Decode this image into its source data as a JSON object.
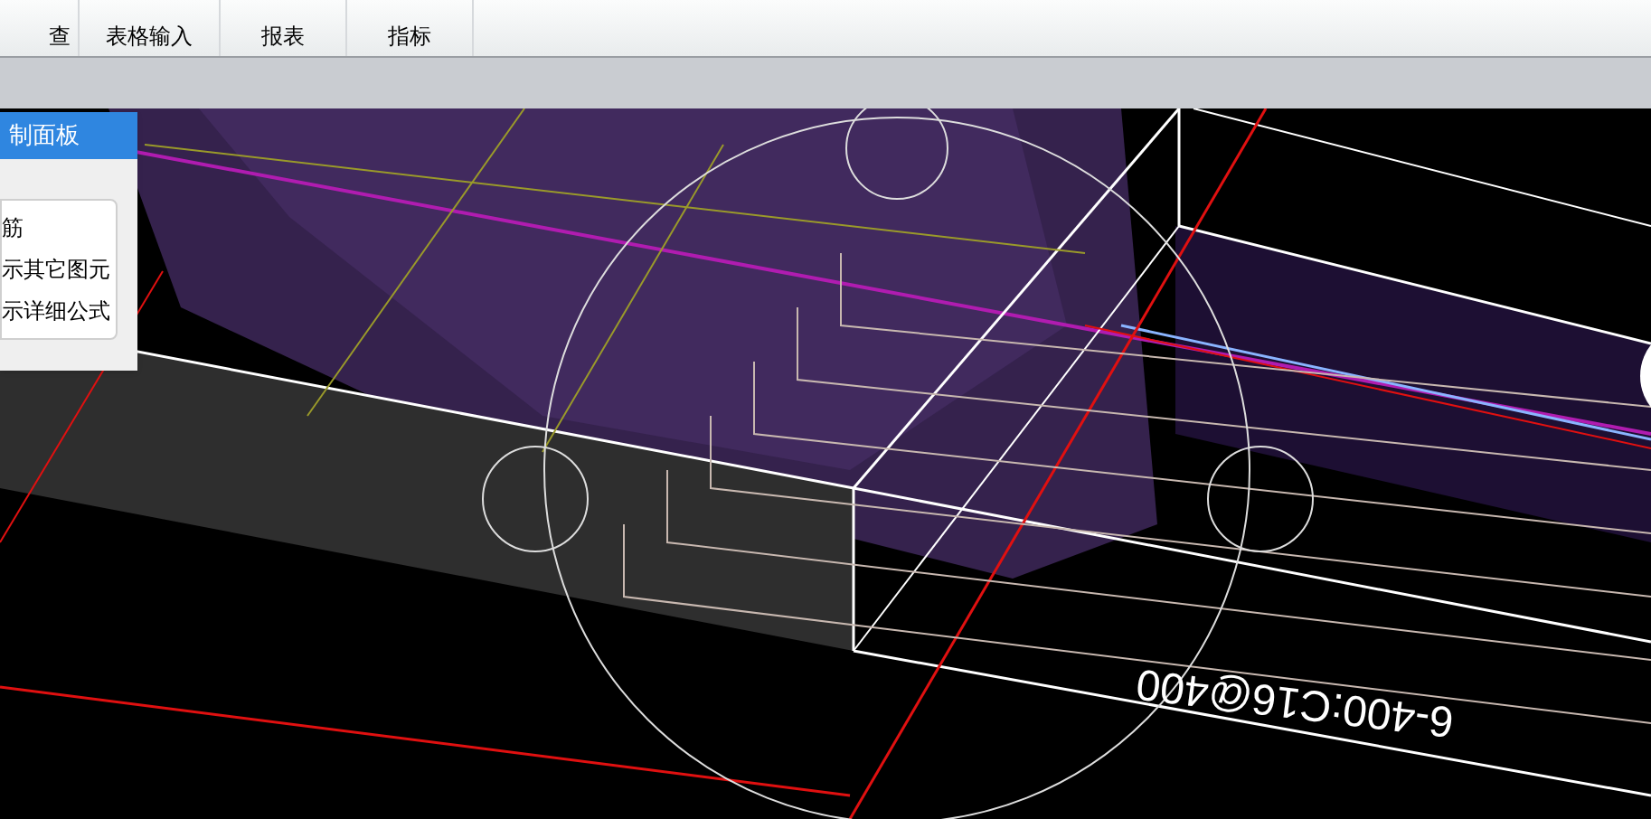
{
  "tabs": [
    {
      "label": "查"
    },
    {
      "label": "表格输入"
    },
    {
      "label": "报表"
    },
    {
      "label": "指标"
    }
  ],
  "control_panel": {
    "title": "制面板",
    "items": [
      "筋",
      "示其它图元",
      "示详细公式"
    ]
  },
  "viewport": {
    "rebar_label": "6-400:C16@400"
  }
}
